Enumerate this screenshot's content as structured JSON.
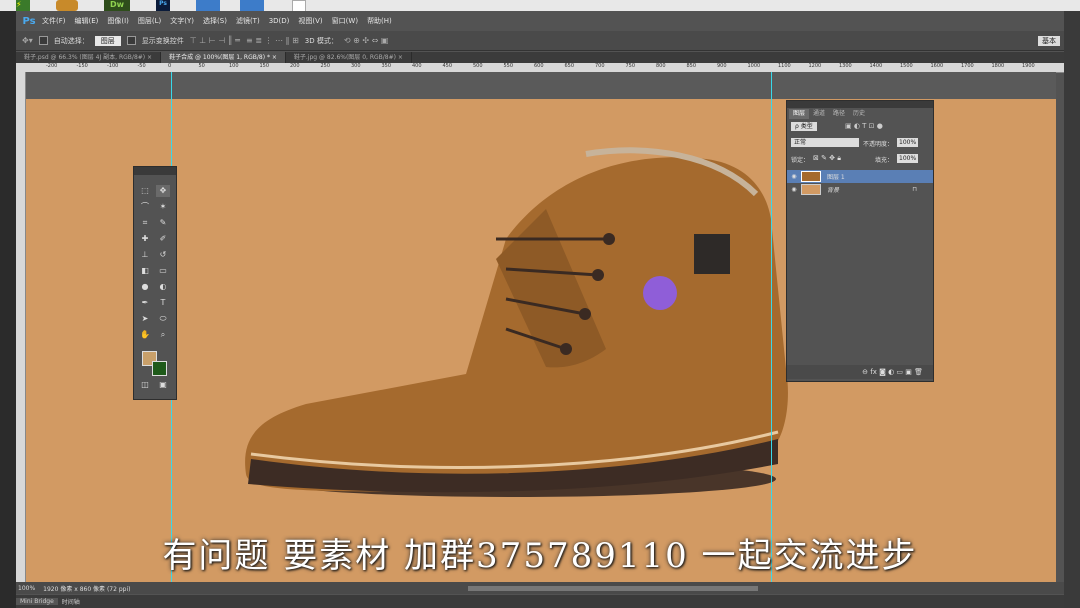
{
  "app": {
    "logo": "Ps"
  },
  "taskbar": {
    "dw_label": "Dw",
    "ps_small": "Ps"
  },
  "menu": [
    "文件(F)",
    "编辑(E)",
    "图像(I)",
    "图层(L)",
    "文字(Y)",
    "选择(S)",
    "滤镜(T)",
    "3D(D)",
    "视图(V)",
    "窗口(W)",
    "帮助(H)"
  ],
  "options": {
    "auto_select_label": "自动选择：",
    "auto_select_value": "图层",
    "show_transform_label": "显示变换控件",
    "mode_3d_label": "3D 模式：",
    "workspace": "基本"
  },
  "tabs": [
    {
      "label": "鞋子.psd @ 66.3% (图层 4J 副本, RGB/8#) ×",
      "active": false
    },
    {
      "label": "鞋子合成 @ 100%(图层 1, RGB/8) * ×",
      "active": true
    },
    {
      "label": "鞋子.jpg @ 82.6%(图层 0, RGB/8#) ×",
      "active": false
    }
  ],
  "ruler_labels": [
    "-200",
    "-150",
    "-100",
    "-50",
    "0",
    "50",
    "100",
    "150",
    "200",
    "250",
    "300",
    "350",
    "400",
    "450",
    "500",
    "550",
    "600",
    "650",
    "700",
    "750",
    "800",
    "850",
    "900",
    "1000",
    "1100",
    "1200",
    "1300",
    "1400",
    "1500",
    "1600",
    "1700",
    "1800",
    "1900"
  ],
  "layers_panel": {
    "tabs": [
      "图层",
      "通道",
      "路径",
      "历史"
    ],
    "kind_label": "ρ 类型",
    "blend_mode": "正常",
    "opacity_label": "不透明度：",
    "opacity_value": "100%",
    "lock_label": "锁定：",
    "fill_label": "填充：",
    "fill_value": "100%",
    "layers": [
      {
        "name": "图层 1",
        "selected": true
      },
      {
        "name": "背景",
        "selected": false,
        "locked": true
      }
    ]
  },
  "subtitle": "有问题  要素材  加群375789110  一起交流进步",
  "status": {
    "zoom": "100%",
    "doc_info": "1920 像素 x 860 像素 (72 ppi)"
  },
  "bottom_tabs": [
    "Mini Bridge",
    "时间轴"
  ],
  "colors": {
    "canvas_bg": "#d29a63",
    "foreground": "#c9a06a",
    "background": "#1f5a1a",
    "guide": "#38d8ea"
  }
}
